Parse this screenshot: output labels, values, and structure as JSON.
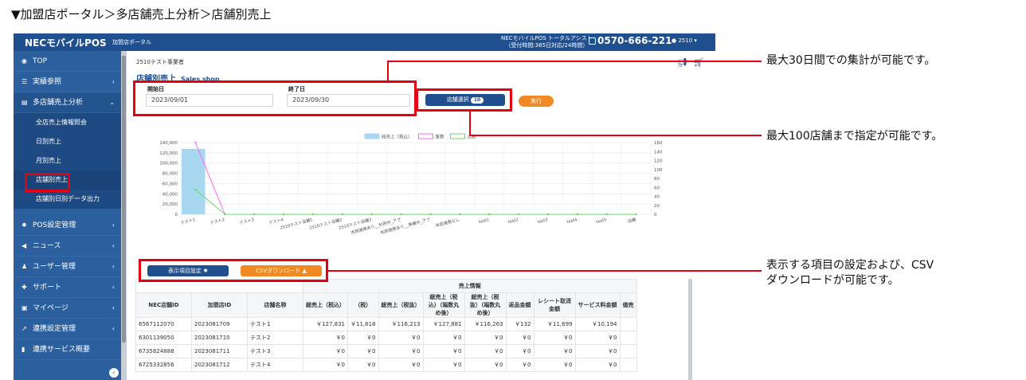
{
  "caption": "▼加盟店ポータル＞多店舗売上分析＞店舗別売上",
  "header": {
    "brand": "NECモバイルPOS",
    "brand_sub": "加盟店ポータル",
    "assist_line1": "NECモバイルPOS トータルアシスト",
    "assist_line2": "（受付時間:365日対応/24時間）",
    "phone": "0570-666-221",
    "user": "2510"
  },
  "sidebar": {
    "items": [
      {
        "label": "TOP"
      },
      {
        "label": "実績参照"
      },
      {
        "label": "多店舗売上分析"
      },
      {
        "label": "POS設定管理"
      },
      {
        "label": "ニュース"
      },
      {
        "label": "ユーザー管理"
      },
      {
        "label": "サポート"
      },
      {
        "label": "マイページ"
      },
      {
        "label": "連携設定管理"
      },
      {
        "label": "連携サービス概要"
      }
    ],
    "subitems": [
      {
        "label": "全店売上情報照会"
      },
      {
        "label": "日別売上"
      },
      {
        "label": "月別売上"
      },
      {
        "label": "店舗別売上"
      },
      {
        "label": "店舗別日別データ出力"
      }
    ]
  },
  "main": {
    "breadcrumb": "2510テスト事業者",
    "title": "店舗別売上",
    "title_en": "Sales shop",
    "start_label": "開始日",
    "start_value": "2023/09/01",
    "end_label": "終了日",
    "end_value": "2023/09/30",
    "store_select_label": "店舗選択",
    "store_count": "10",
    "run_label": "実行",
    "settings_label": "表示項目設定",
    "csv_label": "CSVダウンロード"
  },
  "chart_data": {
    "type": "bar",
    "categories": [
      "テスト1",
      "テスト2",
      "テスト3",
      "テスト4",
      "2510テスト店舗1",
      "2510テスト店舗2",
      "2510テスト店舗3",
      "本部連携あり__利用中_アプ",
      "本部連携あり__準備中_アプ",
      "本部連携なし",
      "test1",
      "test2",
      "test3",
      "test4",
      "test5",
      "店舗"
    ],
    "series": [
      {
        "name": "総売上（税込）",
        "type": "bar",
        "axis": "left",
        "color": "#a8d8f0",
        "values": [
          127831,
          0,
          0,
          0,
          0,
          0,
          0,
          0,
          0,
          0,
          0,
          0,
          0,
          0,
          0,
          0
        ]
      },
      {
        "name": "客数",
        "type": "line",
        "axis": "right",
        "color": "#ff66ff",
        "values": [
          160,
          0,
          0,
          0,
          0,
          0,
          0,
          0,
          0,
          0,
          0,
          0,
          0,
          0,
          0,
          0
        ]
      },
      {
        "name": "点数",
        "type": "line",
        "axis": "right",
        "color": "#66dd66",
        "values": [
          55,
          0,
          0,
          0,
          0,
          0,
          0,
          0,
          0,
          0,
          0,
          0,
          0,
          0,
          0,
          0
        ]
      }
    ],
    "yticks_left": [
      "140,000",
      "120,000",
      "100,000",
      "80,000",
      "60,000",
      "40,000",
      "20,000",
      "0"
    ],
    "yticks_right": [
      "160",
      "140",
      "120",
      "100",
      "80",
      "60",
      "40",
      "20",
      "0"
    ],
    "ylim_left": [
      0,
      140000
    ],
    "ylim_right": [
      0,
      160
    ],
    "legend_position": "top",
    "grid": true
  },
  "table": {
    "group_header": "売上情報",
    "headers": [
      "NEC店舗ID",
      "加盟店ID",
      "店舗名称",
      "総売上（税込）",
      "（税）",
      "総売上（税抜）",
      "総売上（税込）（端数丸め後）",
      "総売上（税抜）（端数丸め後）",
      "返品金額",
      "レシート取消金額",
      "サービス料金額",
      "値売"
    ],
    "rows": [
      [
        "6567112070",
        "2023081709",
        "テスト1",
        "￥127,831",
        "￥11,618",
        "￥116,213",
        "￥127,881",
        "￥116,263",
        "￥132",
        "￥11,699",
        "￥10,194",
        ""
      ],
      [
        "6301139050",
        "2023081710",
        "テスト2",
        "￥0",
        "￥0",
        "￥0",
        "￥0",
        "￥0",
        "￥0",
        "￥0",
        "￥0",
        ""
      ],
      [
        "6735824888",
        "2023081711",
        "テスト3",
        "￥0",
        "￥0",
        "￥0",
        "￥0",
        "￥0",
        "￥0",
        "￥0",
        "￥0",
        ""
      ],
      [
        "6725332856",
        "2023081712",
        "テスト4",
        "￥0",
        "￥0",
        "￥0",
        "￥0",
        "￥0",
        "￥0",
        "￥0",
        "￥0",
        ""
      ]
    ]
  },
  "annotations": {
    "a1": "最大30日間での集計が可能です。",
    "a2": "最大100店舗まで指定が可能です。",
    "a3_line1": "表示する項目の設定および、CSV",
    "a3_line2": "ダウンロードが可能です。"
  },
  "colors": {
    "brand": "#1f4f8f",
    "sidebar": "#2b5f9e",
    "orange": "#f08a24",
    "annotation": "#e60012"
  }
}
